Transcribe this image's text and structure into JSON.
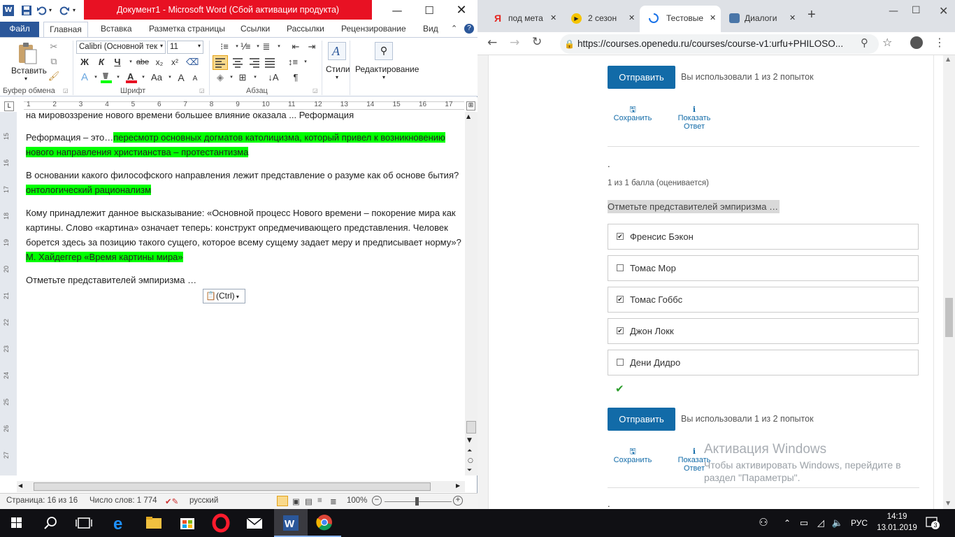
{
  "word": {
    "title": "Документ1  -  Microsoft Word (Сбой активации продукта)",
    "tabs": [
      "Файл",
      "Главная",
      "Вставка",
      "Разметка страницы",
      "Ссылки",
      "Рассылки",
      "Рецензирование",
      "Вид"
    ],
    "ribbon": {
      "paste_label": "Вставить",
      "clipboard_group": "Буфер обмена",
      "font_name": "Calibri (Основной тек",
      "font_size": "11",
      "font_group": "Шрифт",
      "paragraph_group": "Абзац",
      "styles_label": "Стили",
      "editing_label": "Редактирование",
      "bold": "Ж",
      "italic": "К",
      "underline": "Ч",
      "strike": "abe",
      "subscript": "x₂",
      "superscript": "x²",
      "grow": "A",
      "shrink": "A",
      "case": "Aa",
      "pilcrow": "¶"
    },
    "ruler_numbers": [
      "1",
      "2",
      "3",
      "4",
      "5",
      "6",
      "7",
      "8",
      "9",
      "10",
      "11",
      "12",
      "13",
      "14",
      "15",
      "16",
      "17"
    ],
    "left_ruler_numbers": [
      "15",
      "16",
      "17",
      "18",
      "19",
      "20",
      "21",
      "22",
      "23",
      "24",
      "25",
      "26",
      "27"
    ],
    "doc": {
      "p0": "на мировоззрение нового времени большее влияние оказала ... Реформация",
      "p1_plain": "Реформация – это…",
      "p1_hl": "пересмотр основных догматов католицизма, который привел к возникновению нового направления христианства – протестантизма",
      "p2_plain": "В основании какого философского направления лежит представление о разуме как об основе бытия? ",
      "p2_hl": "онтологический рационализм",
      "p3_plain": "Кому принадлежит данное высказывание: «Основной процесс Нового времени – покорение мира как картины. Слово «картина» означает теперь: конструкт опредмечивающего представления. Человек борется здесь за  позицию такого сущего, которое всему сущему задает меру и предписывает норму»? ",
      "p3_hl": "М. Хайдеггер «Время картины мира»",
      "p4": "Отметьте представителей эмпиризма …",
      "paste_ctrl": "(Ctrl)"
    },
    "status": {
      "page": "Страница: 16 из 16",
      "words": "Число слов: 1 774",
      "language": "русский",
      "zoom": "100%"
    }
  },
  "browser": {
    "tabs": [
      {
        "title": "под мета",
        "icon": "yandex-icon"
      },
      {
        "title": "2 сезон",
        "icon": "play-icon"
      },
      {
        "title": "Тестовые",
        "icon": "loading-icon"
      },
      {
        "title": "Диалоги",
        "icon": "chat-icon"
      }
    ],
    "new_tab": "+",
    "url": "https://courses.openedu.ru/courses/course-v1:urfu+PHILOSO...",
    "page": {
      "submit_label": "Отправить",
      "attempts_text": "Вы использовали 1 из 2 попыток",
      "save_label": "Сохранить",
      "show_answer_label_1": "Показать",
      "show_answer_label_2": "Ответ",
      "dot": ".",
      "score": "1 из 1 балла (оценивается)",
      "question": "Отметьте представителей эмпиризма …",
      "options": [
        {
          "label": "Френсис Бэкон",
          "checked": true
        },
        {
          "label": "Томас Мор",
          "checked": false
        },
        {
          "label": "Томас Гоббс",
          "checked": true
        },
        {
          "label": "Джон Локк",
          "checked": true
        },
        {
          "label": "Дени Дидро",
          "checked": false
        }
      ],
      "bottom_dot": "."
    }
  },
  "watermark": {
    "title": "Активация Windows",
    "line1": "Чтобы активировать Windows, перейдите в",
    "line2": "раздел \"Параметры\"."
  },
  "taskbar": {
    "language": "РУС",
    "time": "14:19",
    "date": "13.01.2019",
    "notifications": "3"
  }
}
